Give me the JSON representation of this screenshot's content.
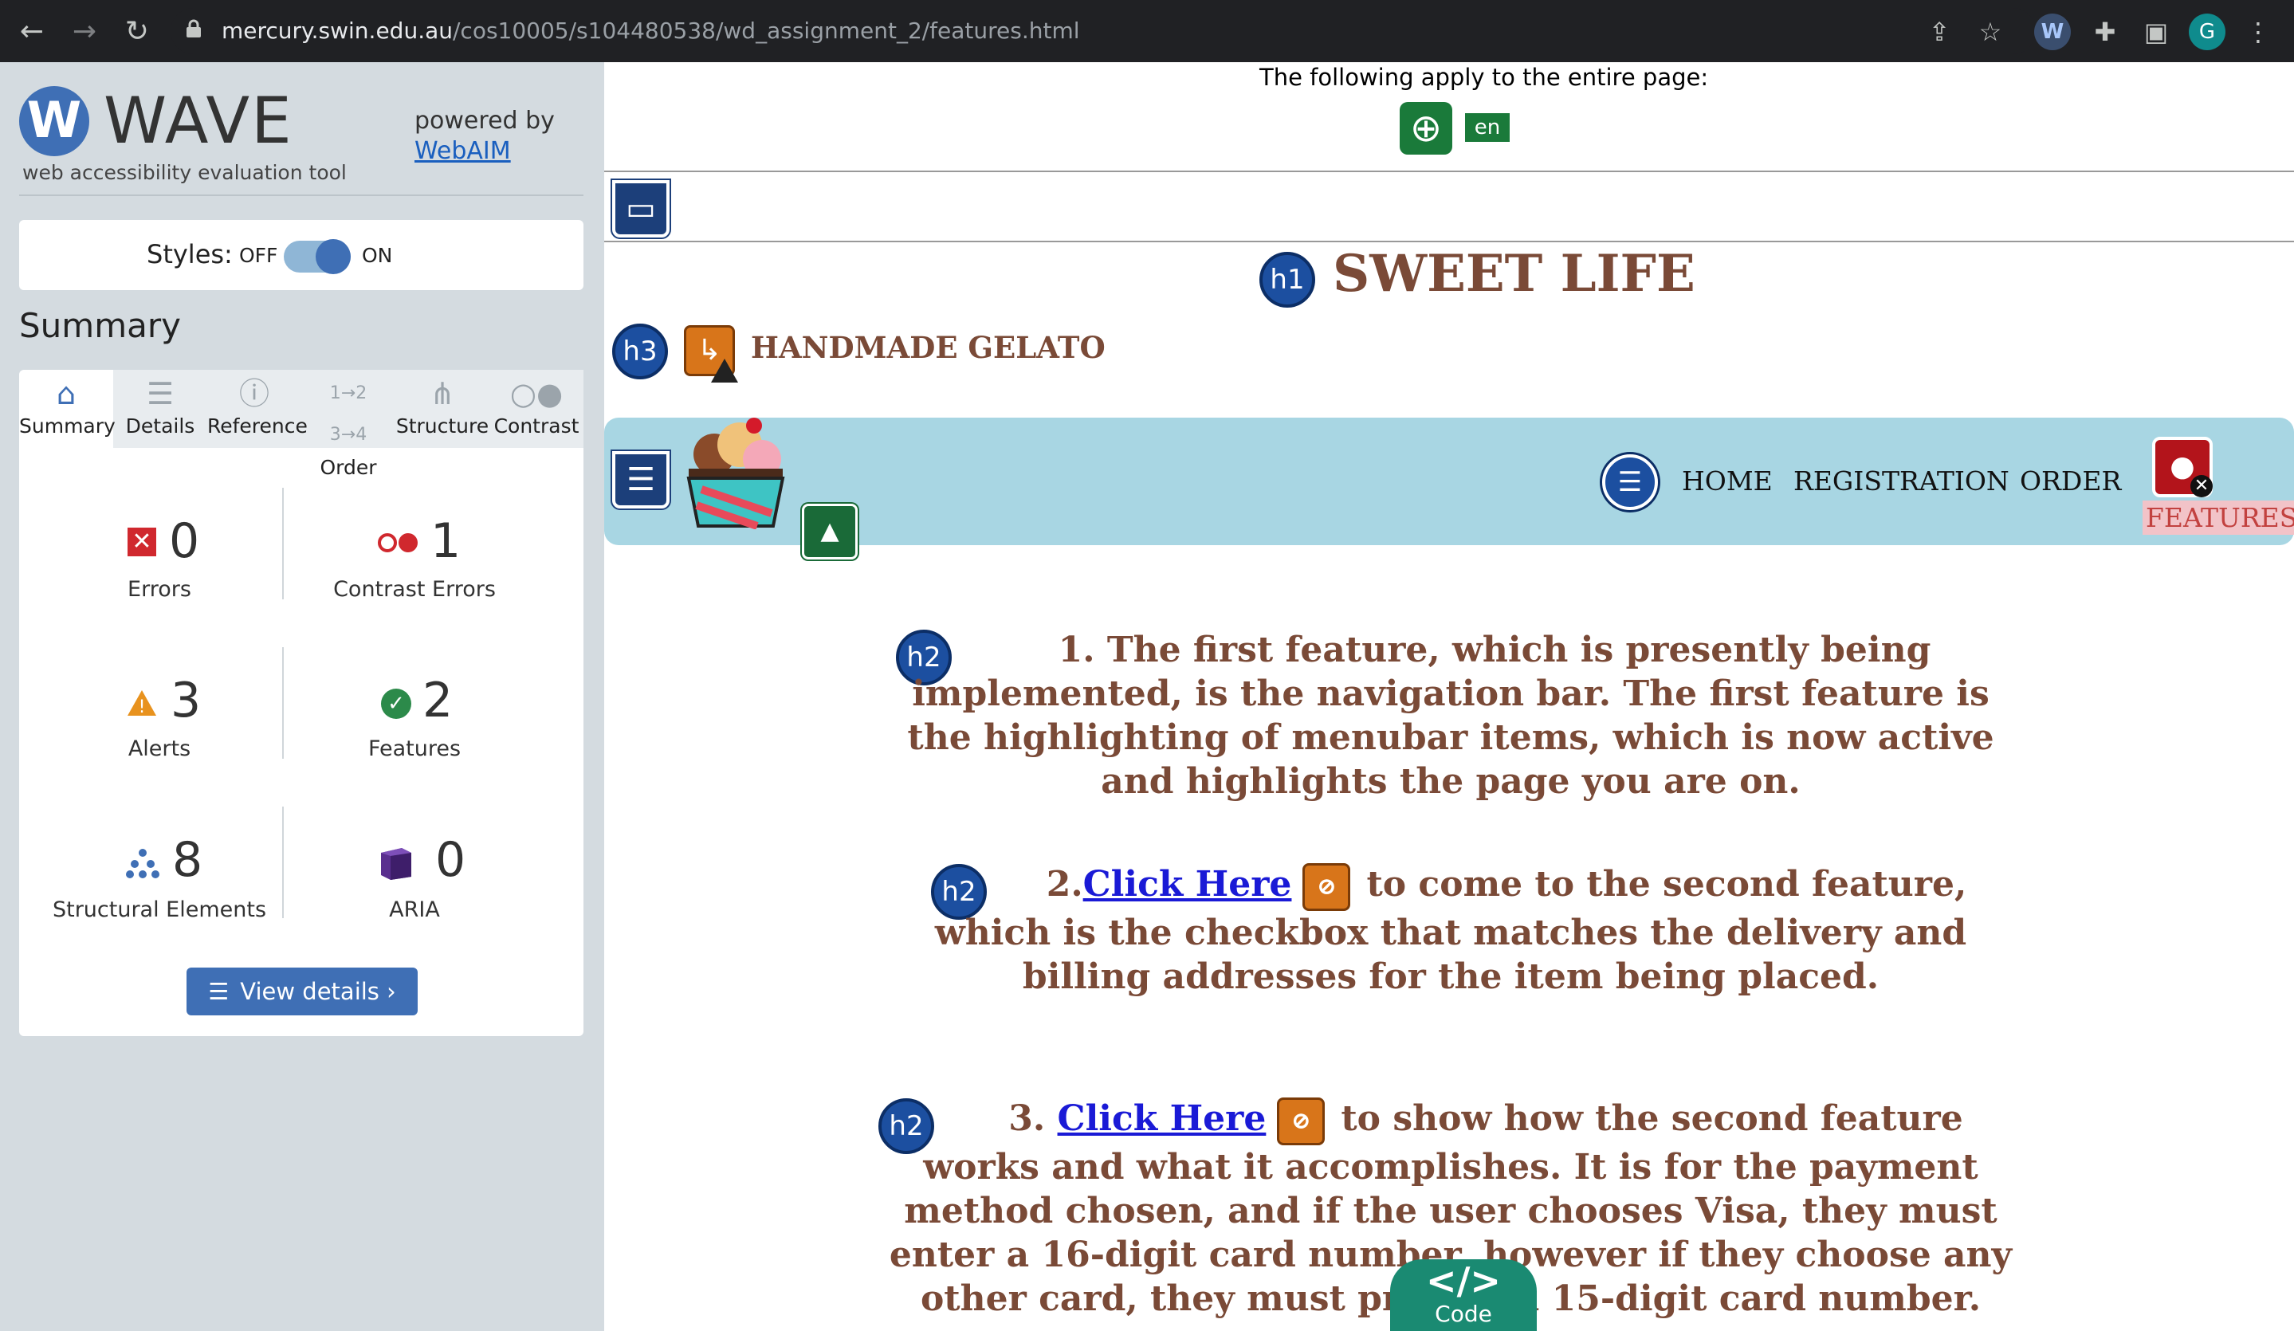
{
  "browser": {
    "url_host": "mercury.swin.edu.au",
    "url_path": "/cos10005/s104480538/wd_assignment_2/features.html",
    "profile_initial": "G"
  },
  "wave": {
    "logo_letter": "W",
    "name": "WAVE",
    "tagline": "web accessibility evaluation tool",
    "powered_by": "powered by",
    "webaim": "WebAIM",
    "styles_label": "Styles:",
    "off": "OFF",
    "on": "ON",
    "summary_title": "Summary",
    "tabs": [
      "Summary",
      "Details",
      "Reference",
      "Order",
      "Structure",
      "Contrast"
    ],
    "stats": {
      "errors": {
        "value": "0",
        "label": "Errors"
      },
      "contrast": {
        "value": "1",
        "label": "Contrast Errors"
      },
      "alerts": {
        "value": "3",
        "label": "Alerts"
      },
      "features": {
        "value": "2",
        "label": "Features"
      },
      "structural": {
        "value": "8",
        "label": "Structural Elements"
      },
      "aria": {
        "value": "0",
        "label": "ARIA"
      }
    },
    "view_details": "View details ›"
  },
  "page": {
    "note": "The following apply to the entire page:",
    "lang": "en",
    "title_heading": "h1",
    "title": "SWEET LIFE",
    "sub_heading": "h3",
    "subtitle": "HANDMADE GELATO",
    "nav": [
      "HOME",
      "REGISTRATION",
      "ORDER",
      "FEATURES"
    ],
    "h2": "h2",
    "para1": "1. The first feature, which is presently being implemented, is the navigation bar. The first feature is the highlighting of menubar items, which is now active and highlights the page you are on.",
    "para2_prefix": "2.",
    "para2_link": "Click Here",
    "para2_suffix": "to come to the second feature, which is the checkbox that matches the delivery and billing addresses for the item being placed.",
    "para3_prefix": "3.",
    "para3_link": "Click Here",
    "para3_suffix": "to show how the second feature works and what it accomplishes. It is for the payment method chosen, and if the user chooses Visa, they must enter a 16-digit card number, however if they choose any other card, they must provide a 15-digit card number.",
    "code_tab": "Code",
    "code_symbol": "</>"
  }
}
